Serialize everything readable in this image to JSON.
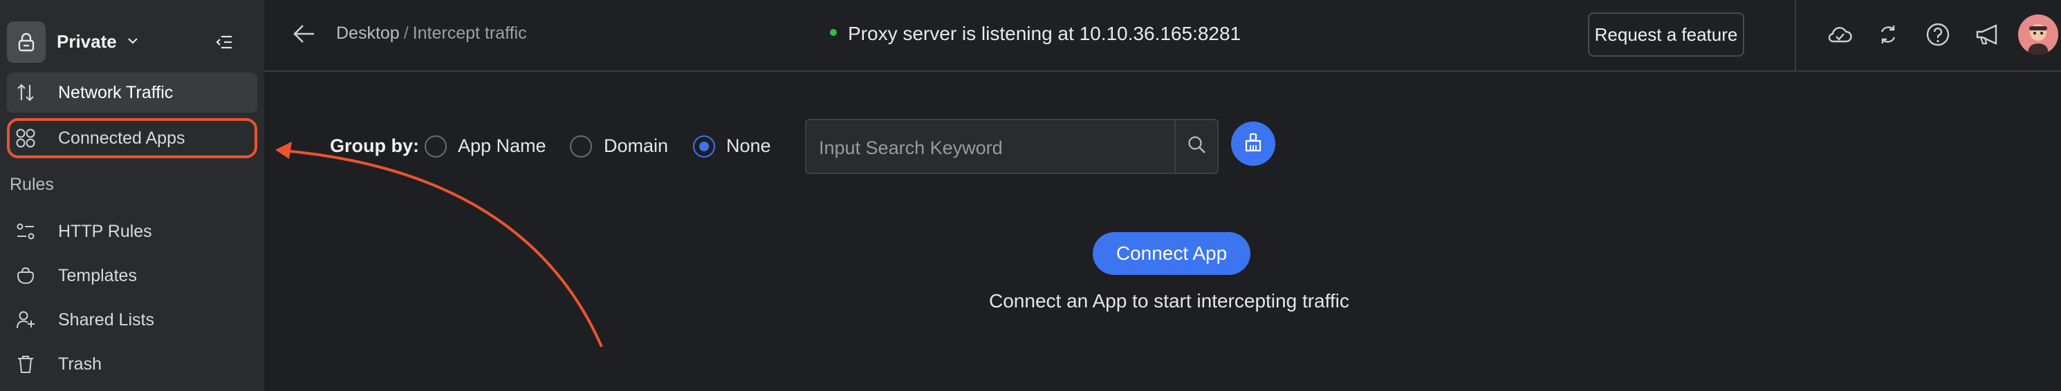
{
  "workspace": {
    "label": "Private"
  },
  "nav": {
    "network_traffic": "Network Traffic",
    "connected_apps": "Connected Apps",
    "rules_section": "Rules",
    "http_rules": "HTTP Rules",
    "templates": "Templates",
    "shared_lists": "Shared Lists",
    "trash": "Trash"
  },
  "header": {
    "breadcrumb_root": "Desktop",
    "breadcrumb_sep": "/",
    "breadcrumb_current": "Intercept traffic",
    "proxy_status": "Proxy server is listening at 10.10.36.165:8281",
    "request_feature": "Request a feature"
  },
  "main": {
    "group_by_label": "Group by:",
    "options": [
      "App Name",
      "Domain",
      "None"
    ],
    "selected_option": "None",
    "search_placeholder": "Input Search Keyword",
    "connect_button": "Connect App",
    "connect_message": "Connect an App to start intercepting traffic"
  },
  "colors": {
    "accent": "#3d74f0",
    "highlight": "#e8552f",
    "status_ok": "#3bb84a"
  },
  "icons": {
    "workspace": "lock-icon",
    "collapse": "collapse-sidebar-icon",
    "network_traffic": "arrows-up-down-icon",
    "connected_apps": "apps-grid-icon",
    "http_rules": "rules-icon",
    "templates": "bag-icon",
    "shared_lists": "user-add-icon",
    "trash": "trash-icon",
    "header_right": [
      "cloud-icon",
      "sync-icon",
      "help-icon",
      "megaphone-icon"
    ]
  }
}
